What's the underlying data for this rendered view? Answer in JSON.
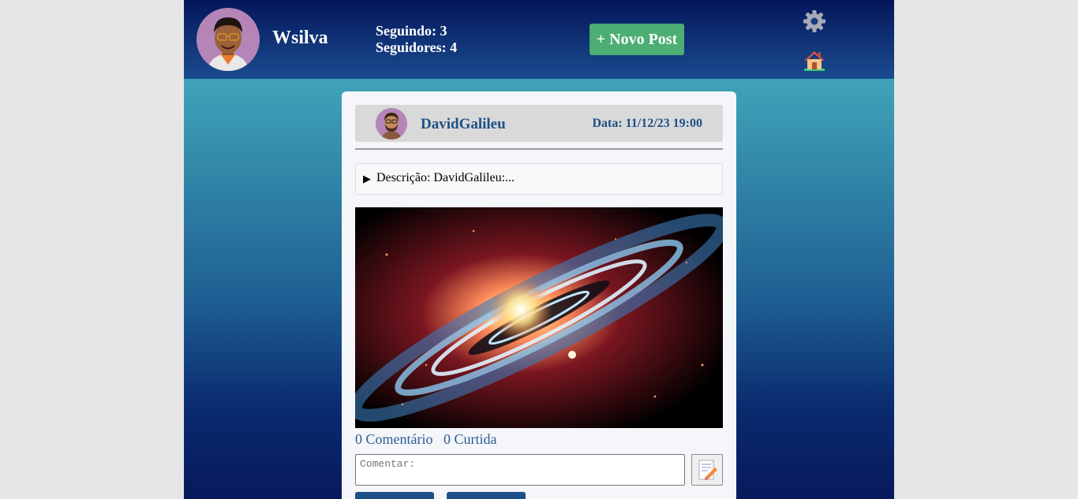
{
  "header": {
    "username": "Wsilva",
    "following": "Seguindo: 3",
    "followers": "Seguidores: 4",
    "new_post_label": "+ Novo Post"
  },
  "post": {
    "author": "DavidGalileu",
    "date": "Data: 11/12/23 19:00",
    "description_toggle": "▶",
    "description": "Descrição: DavidGalileu:...",
    "comment_count": "0 Comentário",
    "like_count": "0 Curtida",
    "comment_placeholder": "Comentar:"
  },
  "colors": {
    "header_gradient": [
      "#05165a",
      "#1a4c8f"
    ],
    "accent_green": "#4cae72",
    "link_blue": "#1e4f86",
    "card_bg": "#f5f6f9"
  },
  "icons": [
    "user-avatar-icon",
    "gear-icon",
    "home-icon",
    "author-avatar-icon",
    "edit-note-icon"
  ]
}
